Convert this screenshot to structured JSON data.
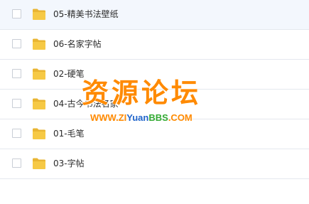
{
  "files": [
    {
      "name": "05-精美书法壁纸"
    },
    {
      "name": "06-名家字帖"
    },
    {
      "name": "02-硬笔"
    },
    {
      "name": "04-古今书法名家"
    },
    {
      "name": "01-毛笔"
    },
    {
      "name": "03-字帖"
    }
  ],
  "watermark": {
    "title": "资源论坛",
    "url_parts": [
      "WWW.",
      "ZI",
      "Yuan",
      "BBS",
      ".COM"
    ]
  },
  "colors": {
    "folder": "#f6c945",
    "watermark_orange": "#ff8a00",
    "row_highlight": "#f3f7fd"
  }
}
